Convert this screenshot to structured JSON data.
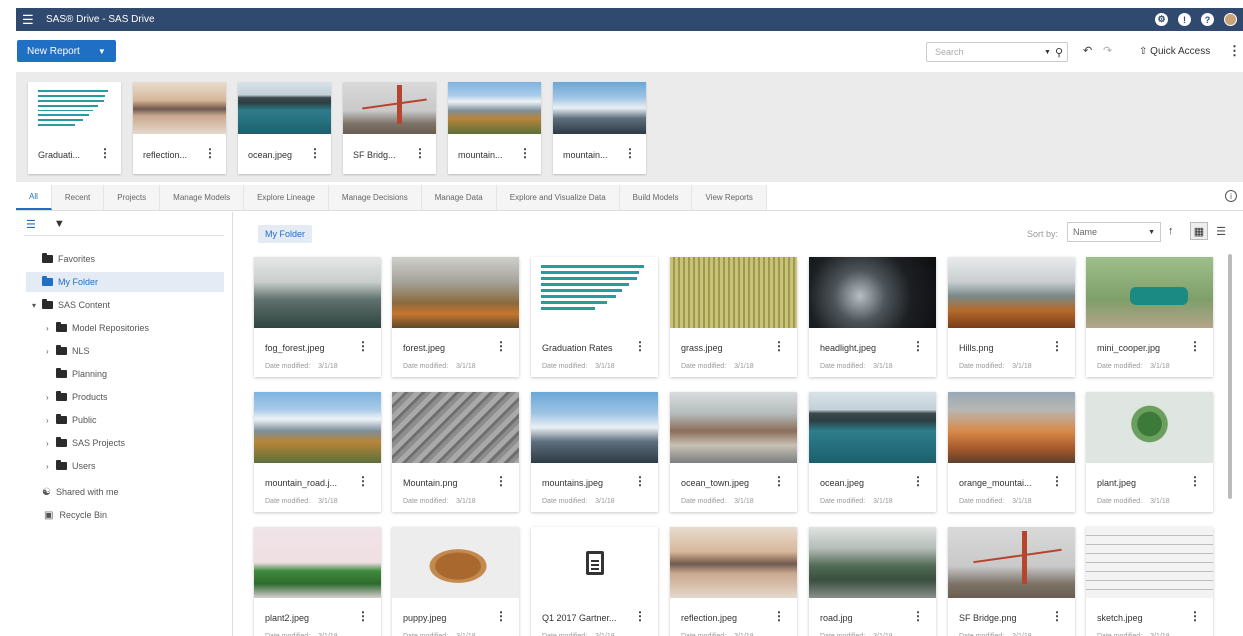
{
  "topbar": {
    "title": "SAS® Drive - SAS Drive"
  },
  "toolbar": {
    "new_report": "New Report",
    "search_placeholder": "Search",
    "quick_access": "Quick Access"
  },
  "recent": [
    {
      "label": "Graduati...",
      "thumb": "bars"
    },
    {
      "label": "reflection...",
      "thumb": "reflection"
    },
    {
      "label": "ocean.jpeg",
      "thumb": "ocean"
    },
    {
      "label": "SF Bridg...",
      "thumb": "bridge"
    },
    {
      "label": "mountain...",
      "thumb": "mountain_road"
    },
    {
      "label": "mountain...",
      "thumb": "mountains"
    }
  ],
  "tabs": [
    "All",
    "Recent",
    "Projects",
    "Manage Models",
    "Explore Lineage",
    "Manage Decisions",
    "Manage Data",
    "Explore and Visualize Data",
    "Build Models",
    "View Reports"
  ],
  "nav": {
    "favorites": "Favorites",
    "my_folder": "My Folder",
    "sas_content": "SAS Content",
    "model_repositories": "Model Repositories",
    "nls": "NLS",
    "planning": "Planning",
    "products": "Products",
    "public": "Public",
    "sas_projects": "SAS Projects",
    "users": "Users",
    "shared": "Shared with me",
    "recycle": "Recycle Bin"
  },
  "main": {
    "breadcrumb": "My Folder",
    "sort_label": "Sort by:",
    "sort_value": "Name",
    "date_label": "Date modified:",
    "date_value": "3/1/18"
  },
  "files": [
    {
      "name": "fog_forest.jpeg",
      "thumb": "fog_forest"
    },
    {
      "name": "forest.jpeg",
      "thumb": "forest"
    },
    {
      "name": "Graduation Rates",
      "thumb": "bars"
    },
    {
      "name": "grass.jpeg",
      "thumb": "grass"
    },
    {
      "name": "headlight.jpeg",
      "thumb": "headlight"
    },
    {
      "name": "Hills.png",
      "thumb": "hills"
    },
    {
      "name": "mini_cooper.jpg",
      "thumb": "mini"
    },
    {
      "name": "mountain_road.j...",
      "thumb": "mountain_road"
    },
    {
      "name": "Mountain.png",
      "thumb": "rock"
    },
    {
      "name": "mountains.jpeg",
      "thumb": "mountains"
    },
    {
      "name": "ocean_town.jpeg",
      "thumb": "town"
    },
    {
      "name": "ocean.jpeg",
      "thumb": "ocean"
    },
    {
      "name": "orange_mountai...",
      "thumb": "orange"
    },
    {
      "name": "plant.jpeg",
      "thumb": "plant"
    },
    {
      "name": "plant2.jpeg",
      "thumb": "plant2"
    },
    {
      "name": "puppy.jpeg",
      "thumb": "puppy"
    },
    {
      "name": "Q1 2017 Gartner...",
      "thumb": "doc"
    },
    {
      "name": "reflection.jpeg",
      "thumb": "reflection"
    },
    {
      "name": "road.jpg",
      "thumb": "road"
    },
    {
      "name": "SF Bridge.png",
      "thumb": "bridge"
    },
    {
      "name": "sketch.jpeg",
      "thumb": "sketch"
    }
  ]
}
